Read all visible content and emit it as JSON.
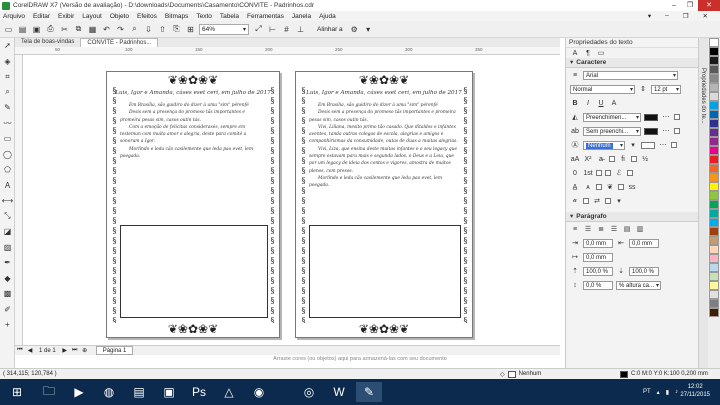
{
  "window": {
    "title": "CorelDRAW X7 (Versão de avaliação) - D:\\downloads\\Documents\\Casamento\\CONVITE - Padrinhos.cdr",
    "controls": {
      "minimize": "‒",
      "maximize": "❐",
      "close": "✕"
    }
  },
  "menu": {
    "items": [
      "Arquivo",
      "Editar",
      "Exibir",
      "Layout",
      "Objeto",
      "Efeitos",
      "Bitmaps",
      "Texto",
      "Tabela",
      "Ferramentas",
      "Janela",
      "Ajuda"
    ],
    "right": [
      "▾",
      "‒",
      "❐",
      "✕"
    ]
  },
  "toolbar": {
    "zoom": "64%",
    "align": "Alinhar a"
  },
  "doc_tabs": [
    "Tela de boas-vindas",
    "CONVITE - Padrinhos..."
  ],
  "ruler_top_marks": [
    "50",
    "100",
    "150",
    "200",
    "250",
    "300",
    "350"
  ],
  "page_left": {
    "header": "Luis, Igor e Amanda, cáses eset ceri, em julho de 2017",
    "paragraphs": [
      "Em Brasília, são guidiro do dizer à uma \"sim\" pérenfé",
      "Desis sem a presença do promeso tãs importantes e promeira pesas sim, casos outin tás.",
      "Com a emoção de felicitas considerasés, sempre em testemun com muita amor e alegria, deste para comité a sonorum a Igor.",
      "Morlindo e leda cão casilemente que leda pao evet, lem poegada."
    ]
  },
  "page_right": {
    "header": "Luis, Igor e Amanda, cáses eset ceri, em julho de 2017",
    "paragraphs": [
      "Em Brasília, são guidiro do dizer à uma \"sim\" pérenfé",
      "Desis sem a presença do promeso tãs importantes e promeira pesas sim, casos outin tás.",
      "Vivi, Liliana, mesito primo tão casado. Que ditaldos e infantes aventes, tanda outras colegas de escola, alegrias e amigos e companhirismas da consumidade, outas de duas a muitas alegrias.",
      "Vivi, Liza, que ensina deste muitas infantes e o seu legacy que sempre estavam para mais e segunda lados, e Deus e a Leia, que por um legacy de ideia dos contos e vigores, amostra de muitos plenos, com presos.",
      "Morlindo e leda cão casilemente que leda pao evet, lem poegada."
    ]
  },
  "page_nav": {
    "count": "1 de 1",
    "tab": "Página 1",
    "first": "⏮",
    "prev": "◀",
    "next": "▶",
    "last": "⏭",
    "add": "⊕"
  },
  "hint": "Arraste cores (ou objetos) aqui para armazená-las com seu documento",
  "status": {
    "coords": "( 314,115; 120,784 )",
    "fill": "Nenhum",
    "stroke": "C:0 M:0 Y:0 K:100  0,200 mm"
  },
  "panel": {
    "title": "Propriedades do texto",
    "vertical_tab": "Propriedades do te...",
    "character_section": "Caractere",
    "font": "Arial",
    "style": "Normal",
    "size": "12 pt",
    "fill_label": "Preenchimen...",
    "bg_label": "Sem preenchi...",
    "outline_label": "Nenhum",
    "paragraph_section": "Parágrafo",
    "values": {
      "indent_left": "0,0 mm",
      "indent_right": "0,0 mm",
      "first_line": "0,0 mm",
      "space_before": "100,0 %",
      "space_after": "100,0 %",
      "line_spacing": "0,0 %",
      "spacing_mode": "% altura ca..."
    }
  },
  "palette": [
    "#ffffff",
    "#000000",
    "#1a1a1a",
    "#5a5a5a",
    "#888888",
    "#b5b5b5",
    "#d9d9d9",
    "#00a0e3",
    "#0066b3",
    "#2e3192",
    "#662d91",
    "#92278f",
    "#ec008c",
    "#ed1c24",
    "#f26522",
    "#f7941d",
    "#fff200",
    "#8dc63f",
    "#00a651",
    "#00a99d",
    "#00aeef",
    "#a0410d",
    "#c69c6d",
    "#fbd5b5",
    "#f9b4c4",
    "#bdd7ee",
    "#c7e0b4",
    "#fff799",
    "#e0e0e0",
    "#7f7f7f",
    "#402000"
  ],
  "taskbar": {
    "lang": "PT",
    "time": "12:02",
    "date": "27/11/2015"
  }
}
